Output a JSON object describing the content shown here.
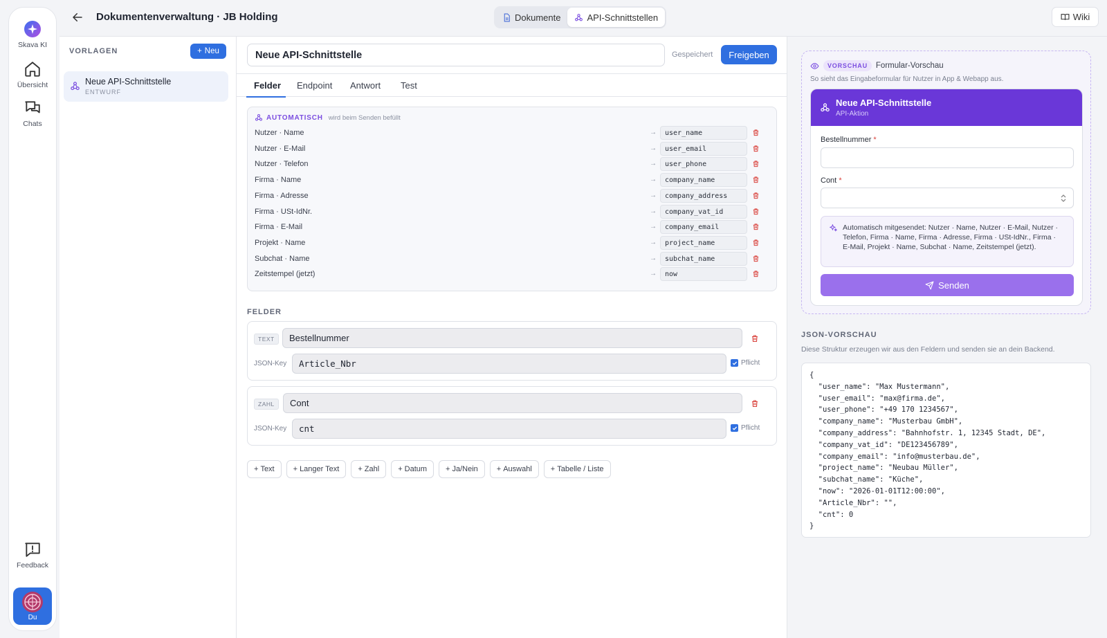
{
  "nav": {
    "items": [
      {
        "label": "Skava KI",
        "icon": "skava-logo-icon"
      },
      {
        "label": "Übersicht",
        "icon": "home-icon"
      },
      {
        "label": "Chats",
        "icon": "chats-icon"
      }
    ],
    "feedback_label": "Feedback",
    "user_label": "Du"
  },
  "header": {
    "title": "Dokumentenverwaltung · JB Holding",
    "tabs": [
      {
        "label": "Dokumente",
        "active": false
      },
      {
        "label": "API-Schnittstellen",
        "active": true
      }
    ],
    "wiki_label": "Wiki"
  },
  "templates": {
    "heading": "VORLAGEN",
    "new_label": "Neu",
    "items": [
      {
        "name": "Neue API-Schnittstelle",
        "status": "ENTWURF"
      }
    ]
  },
  "editor": {
    "name_value": "Neue API-Schnittstelle",
    "saved_label": "Gespeichert",
    "release_label": "Freigeben",
    "tabs": [
      "Felder",
      "Endpoint",
      "Antwort",
      "Test"
    ],
    "active_tab": "Felder",
    "auto": {
      "label": "AUTOMATISCH",
      "sub": "wird beim Senden befüllt",
      "rows": [
        {
          "label": "Nutzer · Name",
          "key": "user_name"
        },
        {
          "label": "Nutzer · E-Mail",
          "key": "user_email"
        },
        {
          "label": "Nutzer · Telefon",
          "key": "user_phone"
        },
        {
          "label": "Firma · Name",
          "key": "company_name"
        },
        {
          "label": "Firma · Adresse",
          "key": "company_address"
        },
        {
          "label": "Firma · USt-IdNr.",
          "key": "company_vat_id"
        },
        {
          "label": "Firma · E-Mail",
          "key": "company_email"
        },
        {
          "label": "Projekt · Name",
          "key": "project_name"
        },
        {
          "label": "Subchat · Name",
          "key": "subchat_name"
        },
        {
          "label": "Zeitstempel (jetzt)",
          "key": "now"
        }
      ]
    },
    "fields_heading": "FELDER",
    "json_key_label": "JSON-Key",
    "required_label": "Pflicht",
    "fields": [
      {
        "type": "TEXT",
        "label": "Bestellnummer",
        "key": "Article_Nbr",
        "required": true
      },
      {
        "type": "ZAHL",
        "label": "Cont",
        "key": "cnt",
        "required": true
      }
    ],
    "add_buttons": [
      "Text",
      "Langer Text",
      "Zahl",
      "Datum",
      "Ja/Nein",
      "Auswahl",
      "Tabelle / Liste"
    ]
  },
  "preview": {
    "badge": "VORSCHAU",
    "title": "Formular-Vorschau",
    "desc": "So sieht das Eingabeformular für Nutzer in App & Webapp aus.",
    "form_title": "Neue API-Schnittstelle",
    "form_sub": "API-Aktion",
    "field1_label": "Bestellnummer",
    "field2_label": "Cont",
    "required_mark": "*",
    "note": "Automatisch mitgesendet: Nutzer · Name, Nutzer · E-Mail, Nutzer · Telefon, Firma · Name, Firma · Adresse, Firma · USt-IdNr., Firma · E-Mail, Projekt · Name, Subchat · Name, Zeitstempel (jetzt).",
    "send_label": "Senden"
  },
  "json_preview": {
    "heading": "JSON-VORSCHAU",
    "desc": "Diese Struktur erzeugen wir aus den Feldern und senden sie an dein Backend.",
    "code": "{\n  \"user_name\": \"Max Mustermann\",\n  \"user_email\": \"max@firma.de\",\n  \"user_phone\": \"+49 170 1234567\",\n  \"company_name\": \"Musterbau GmbH\",\n  \"company_address\": \"Bahnhofstr. 1, 12345 Stadt, DE\",\n  \"company_vat_id\": \"DE123456789\",\n  \"company_email\": \"info@musterbau.de\",\n  \"project_name\": \"Neubau Müller\",\n  \"subchat_name\": \"Küche\",\n  \"now\": \"2026-01-01T12:00:00\",\n  \"Article_Nbr\": \"\",\n  \"cnt\": 0\n}"
  },
  "colors": {
    "accent": "#2f6fe0",
    "purple": "#6a37d8",
    "danger": "#d9403a"
  }
}
